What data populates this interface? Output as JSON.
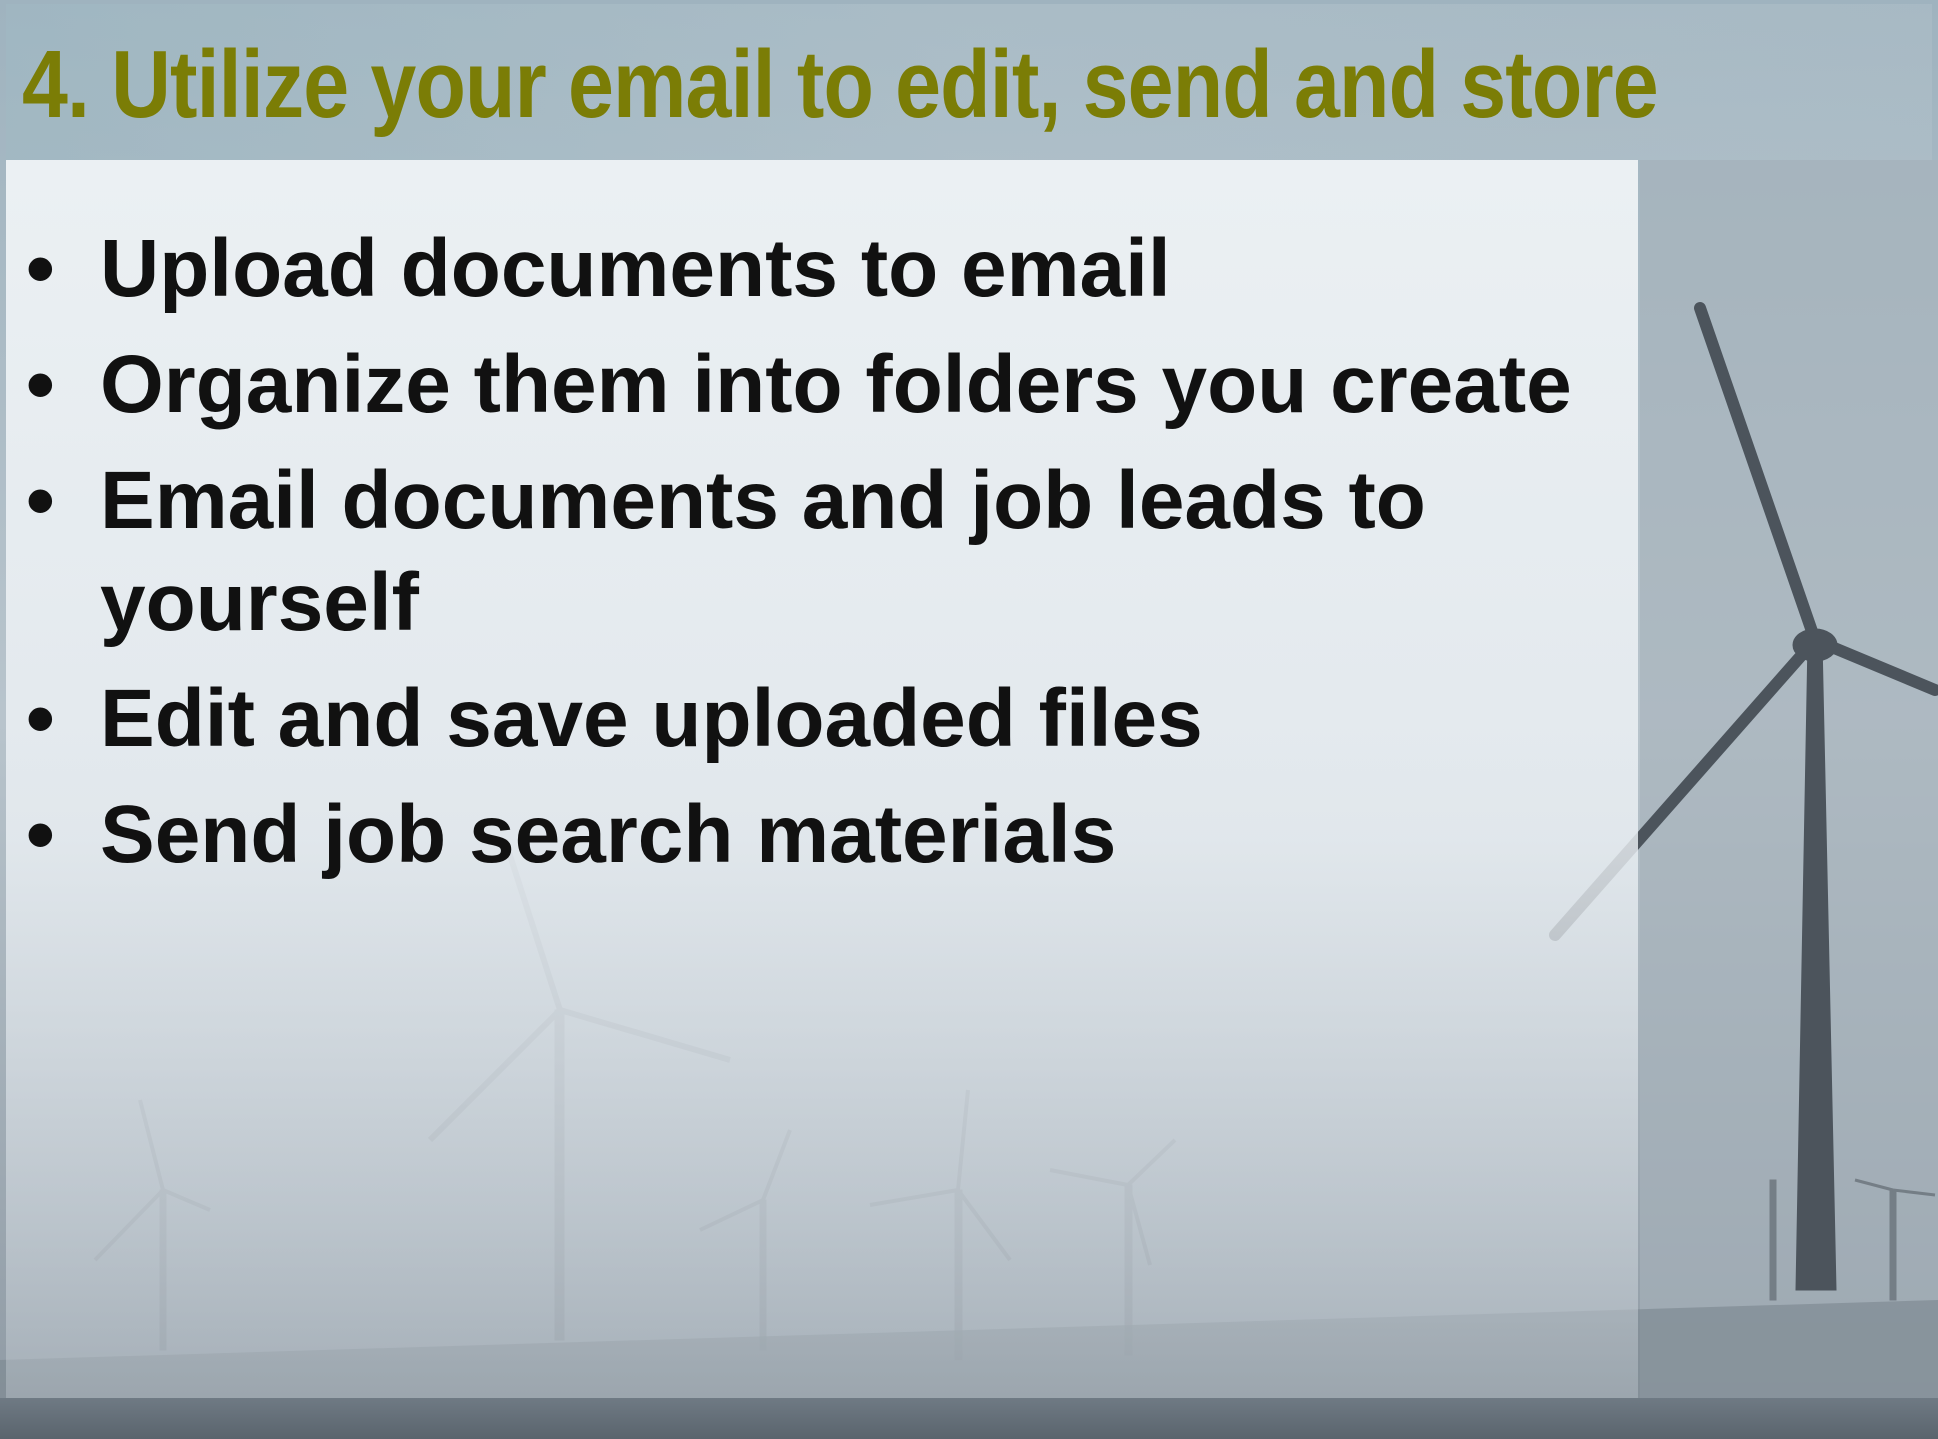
{
  "slide": {
    "title": "4. Utilize your email to edit, send and store",
    "bullet_symbol": "•",
    "bullets": [
      "Upload documents to email",
      "Organize them into folders you create",
      "Email documents and job leads to yourself",
      "Edit and save uploaded files",
      "Send job search materials"
    ],
    "colors": {
      "title": "#7b7d06",
      "body_text": "#111111",
      "background": "#b9c6cf"
    },
    "background_image": "wind-turbines-photo"
  }
}
